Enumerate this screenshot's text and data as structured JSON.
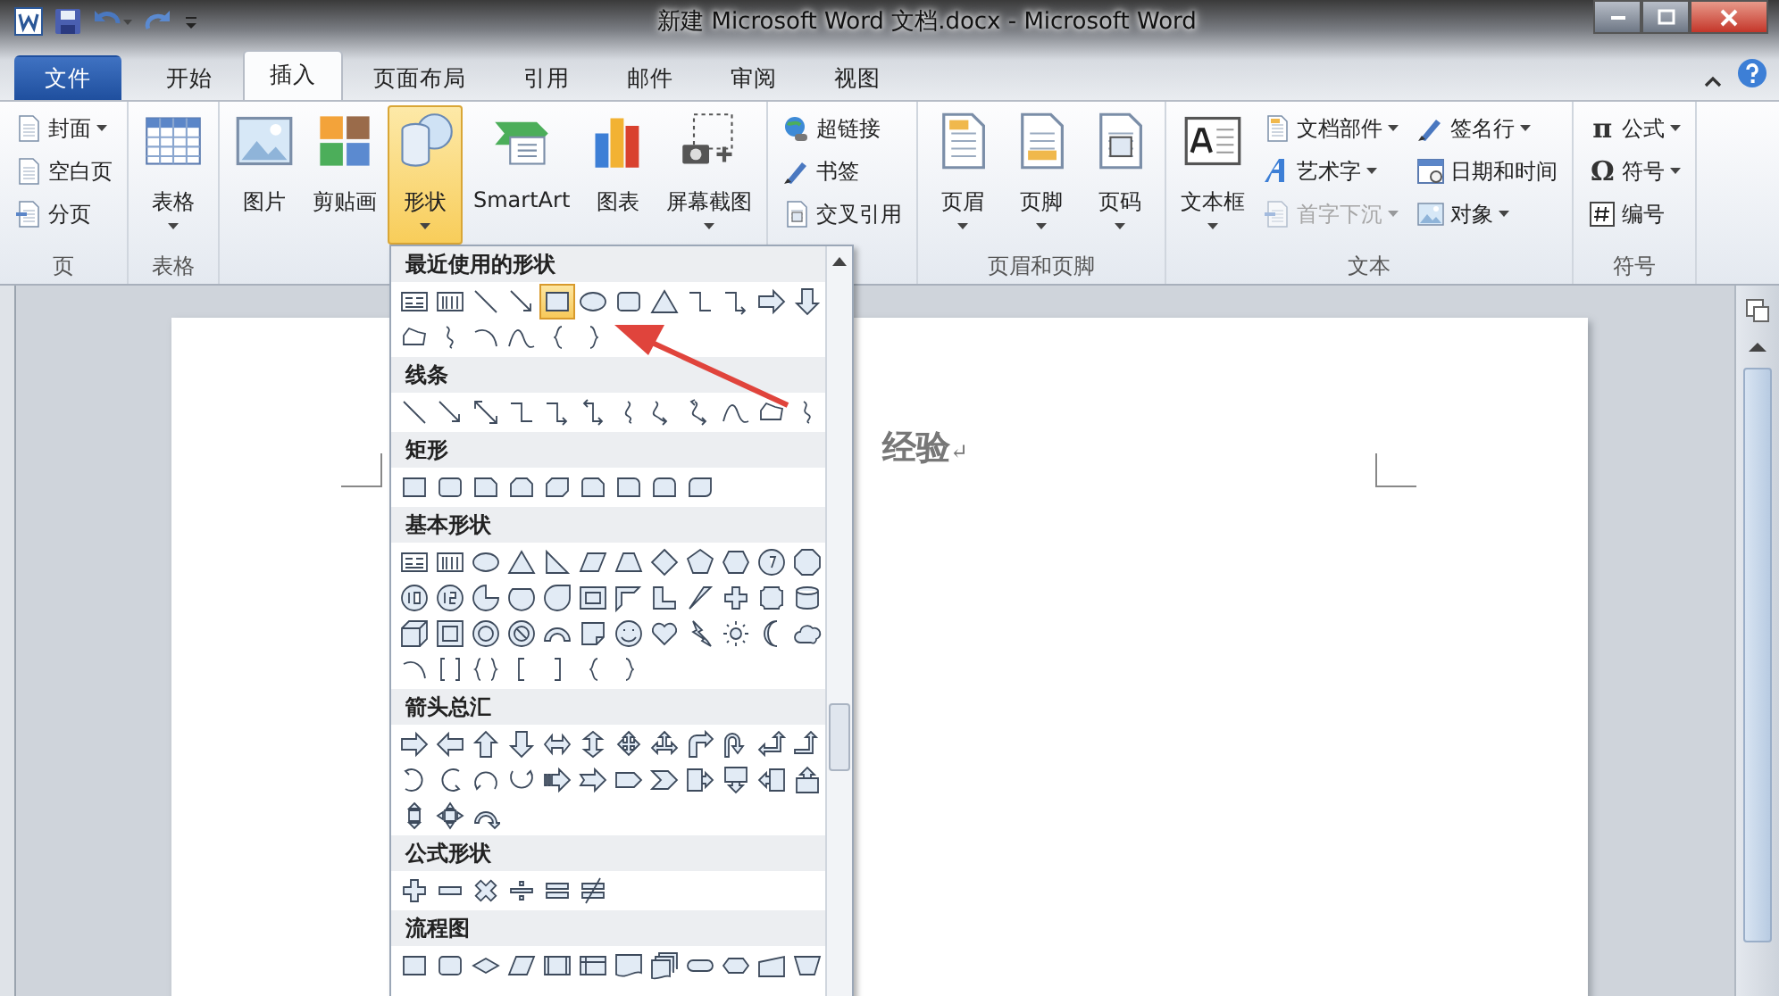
{
  "window": {
    "title": "新建 Microsoft Word 文档.docx - Microsoft Word"
  },
  "tabs": [
    {
      "label": "文件",
      "kind": "file",
      "selected": false
    },
    {
      "label": "开始",
      "kind": "tab",
      "selected": false
    },
    {
      "label": "插入",
      "kind": "tab",
      "selected": true
    },
    {
      "label": "页面布局",
      "kind": "tab",
      "selected": false
    },
    {
      "label": "引用",
      "kind": "tab",
      "selected": false
    },
    {
      "label": "邮件",
      "kind": "tab",
      "selected": false
    },
    {
      "label": "审阅",
      "kind": "tab",
      "selected": false
    },
    {
      "label": "视图",
      "kind": "tab",
      "selected": false
    }
  ],
  "ribbon": {
    "groups": [
      {
        "label": "页",
        "columns": [
          [
            {
              "kind": "small",
              "label": "封面",
              "dropdown": true,
              "pressed": false,
              "disabled": false
            },
            {
              "kind": "small",
              "label": "空白页",
              "dropdown": false,
              "pressed": false,
              "disabled": false
            },
            {
              "kind": "small",
              "label": "分页",
              "dropdown": false,
              "pressed": false,
              "disabled": false
            }
          ]
        ]
      },
      {
        "label": "表格",
        "columns": [
          [
            {
              "kind": "large",
              "label": "表格",
              "dropdown": true,
              "pressed": false,
              "disabled": false
            }
          ]
        ]
      },
      {
        "columns": [
          [
            {
              "kind": "large",
              "label": "图片",
              "dropdown": false,
              "pressed": false,
              "disabled": false
            }
          ],
          [
            {
              "kind": "large",
              "label": "剪贴画",
              "dropdown": false,
              "pressed": false,
              "disabled": false
            }
          ],
          [
            {
              "kind": "large",
              "label": "形状",
              "dropdown": true,
              "pressed": true,
              "disabled": false
            }
          ],
          [
            {
              "kind": "large",
              "label": "SmartArt",
              "dropdown": false,
              "pressed": false,
              "disabled": false
            }
          ],
          [
            {
              "kind": "large",
              "label": "图表",
              "dropdown": false,
              "pressed": false,
              "disabled": false
            }
          ],
          [
            {
              "kind": "large",
              "label": "屏幕截图",
              "dropdown": true,
              "pressed": false,
              "disabled": false
            }
          ]
        ]
      },
      {
        "columns": [
          [
            {
              "kind": "small",
              "label": "超链接",
              "dropdown": false,
              "pressed": false,
              "disabled": false
            },
            {
              "kind": "small",
              "label": "书签",
              "dropdown": false,
              "pressed": false,
              "disabled": false
            },
            {
              "kind": "small",
              "label": "交叉引用",
              "dropdown": false,
              "pressed": false,
              "disabled": false
            }
          ]
        ]
      },
      {
        "label": "页眉和页脚",
        "columns": [
          [
            {
              "kind": "large",
              "label": "页眉",
              "dropdown": true,
              "pressed": false,
              "disabled": false
            }
          ],
          [
            {
              "kind": "large",
              "label": "页脚",
              "dropdown": true,
              "pressed": false,
              "disabled": false
            }
          ],
          [
            {
              "kind": "large",
              "label": "页码",
              "dropdown": true,
              "pressed": false,
              "disabled": false
            }
          ]
        ]
      },
      {
        "label": "文本",
        "columns": [
          [
            {
              "kind": "large",
              "label": "文本框",
              "dropdown": true,
              "pressed": false,
              "disabled": false
            }
          ],
          [
            {
              "kind": "small",
              "label": "文档部件",
              "dropdown": true,
              "pressed": false,
              "disabled": false
            },
            {
              "kind": "small",
              "label": "艺术字",
              "dropdown": true,
              "pressed": false,
              "disabled": false
            },
            {
              "kind": "small",
              "label": "首字下沉",
              "dropdown": true,
              "pressed": false,
              "disabled": true
            }
          ],
          [
            {
              "kind": "small",
              "label": "签名行",
              "dropdown": true,
              "pressed": false,
              "disabled": false
            },
            {
              "kind": "small",
              "label": "日期和时间",
              "dropdown": false,
              "pressed": false,
              "disabled": false
            },
            {
              "kind": "small",
              "label": "对象",
              "dropdown": true,
              "pressed": false,
              "disabled": false
            }
          ]
        ]
      },
      {
        "label": "符号",
        "columns": [
          [
            {
              "kind": "small",
              "label": "公式",
              "glyph": "π",
              "dropdown": true,
              "pressed": false,
              "disabled": false
            },
            {
              "kind": "small",
              "label": "符号",
              "glyph": "Ω",
              "dropdown": true,
              "pressed": false,
              "disabled": false
            },
            {
              "kind": "small",
              "label": "编号",
              "dropdown": false,
              "pressed": false,
              "disabled": false
            }
          ]
        ]
      }
    ]
  },
  "shapes_menu": {
    "sections": [
      {
        "title": "最近使用的形状",
        "shapes": [
          {
            "kind": "textbox",
            "selected": false
          },
          {
            "kind": "vtextbox",
            "selected": false
          },
          {
            "kind": "line",
            "selected": false
          },
          {
            "kind": "arrow-line",
            "selected": false
          },
          {
            "kind": "rect",
            "selected": true
          },
          {
            "kind": "ellipse",
            "selected": false
          },
          {
            "kind": "round-rect",
            "selected": false
          },
          {
            "kind": "triangle",
            "selected": false
          },
          {
            "kind": "elbow",
            "selected": false
          },
          {
            "kind": "elbow-arrow",
            "selected": false
          },
          {
            "kind": "arrow-right",
            "selected": false
          },
          {
            "kind": "arrow-down",
            "selected": false
          },
          {
            "kind": "freeform",
            "selected": false
          },
          {
            "kind": "scribble",
            "selected": false
          },
          {
            "kind": "arc",
            "selected": false
          },
          {
            "kind": "curve",
            "selected": false
          },
          {
            "kind": "brace-left",
            "selected": false
          },
          {
            "kind": "brace-right",
            "selected": false
          }
        ]
      },
      {
        "title": "线条",
        "shapes": [
          {
            "kind": "line",
            "selected": false
          },
          {
            "kind": "arrow-line",
            "selected": false
          },
          {
            "kind": "double-arrow",
            "selected": false
          },
          {
            "kind": "elbow",
            "selected": false
          },
          {
            "kind": "elbow-arrow",
            "selected": false
          },
          {
            "kind": "elbow-double",
            "selected": false
          },
          {
            "kind": "curve-s",
            "selected": false
          },
          {
            "kind": "curve-arrow",
            "selected": false
          },
          {
            "kind": "curve-double",
            "selected": false
          },
          {
            "kind": "curve",
            "selected": false
          },
          {
            "kind": "freeform",
            "selected": false
          },
          {
            "kind": "scribble",
            "selected": false
          }
        ]
      },
      {
        "title": "矩形",
        "shapes": [
          {
            "kind": "rect",
            "selected": false
          },
          {
            "kind": "round-rect",
            "selected": false
          },
          {
            "kind": "snip",
            "selected": false
          },
          {
            "kind": "snip-two",
            "selected": false
          },
          {
            "kind": "snip-diag",
            "selected": false
          },
          {
            "kind": "snip-round",
            "selected": false
          },
          {
            "kind": "round-one",
            "selected": false
          },
          {
            "kind": "round-two",
            "selected": false
          },
          {
            "kind": "round-diag",
            "selected": false
          }
        ]
      },
      {
        "title": "基本形状",
        "shapes": [
          {
            "kind": "textbox",
            "selected": false
          },
          {
            "kind": "vtextbox",
            "selected": false
          },
          {
            "kind": "ellipse",
            "selected": false
          },
          {
            "kind": "triangle",
            "selected": false
          },
          {
            "kind": "right-triangle",
            "selected": false
          },
          {
            "kind": "parallelogram",
            "selected": false
          },
          {
            "kind": "trapezoid",
            "selected": false
          },
          {
            "kind": "diamond",
            "selected": false
          },
          {
            "kind": "pentagon",
            "selected": false
          },
          {
            "kind": "hexagon",
            "selected": false
          },
          {
            "kind": "heptagon",
            "selected": false
          },
          {
            "kind": "octagon",
            "selected": false
          },
          {
            "kind": "decagon",
            "selected": false
          },
          {
            "kind": "dodecagon",
            "selected": false
          },
          {
            "kind": "pie",
            "selected": false
          },
          {
            "kind": "chord",
            "selected": false
          },
          {
            "kind": "teardrop",
            "selected": false
          },
          {
            "kind": "frame",
            "selected": false
          },
          {
            "kind": "half-frame",
            "selected": false
          },
          {
            "kind": "l-shape",
            "selected": false
          },
          {
            "kind": "stripe",
            "selected": false
          },
          {
            "kind": "cross",
            "selected": false
          },
          {
            "kind": "plaque",
            "selected": false
          },
          {
            "kind": "can",
            "selected": false
          },
          {
            "kind": "cube",
            "selected": false
          },
          {
            "kind": "bevel",
            "selected": false
          },
          {
            "kind": "donut",
            "selected": false
          },
          {
            "kind": "no-symbol",
            "selected": false
          },
          {
            "kind": "block-arc",
            "selected": false
          },
          {
            "kind": "folded",
            "selected": false
          },
          {
            "kind": "smiley",
            "selected": false
          },
          {
            "kind": "heart",
            "selected": false
          },
          {
            "kind": "lightning",
            "selected": false
          },
          {
            "kind": "sun",
            "selected": false
          },
          {
            "kind": "moon",
            "selected": false
          },
          {
            "kind": "cloud",
            "selected": false
          },
          {
            "kind": "arc",
            "selected": false
          },
          {
            "kind": "bracket-pair",
            "selected": false
          },
          {
            "kind": "brace-pair",
            "selected": false
          },
          {
            "kind": "bracket-left",
            "selected": false
          },
          {
            "kind": "bracket-right",
            "selected": false
          },
          {
            "kind": "brace-left",
            "selected": false
          },
          {
            "kind": "brace-right",
            "selected": false
          }
        ]
      },
      {
        "title": "箭头总汇",
        "shapes": [
          {
            "kind": "arrow-right",
            "selected": false
          },
          {
            "kind": "arrow-left",
            "selected": false
          },
          {
            "kind": "arrow-up",
            "selected": false
          },
          {
            "kind": "arrow-down",
            "selected": false
          },
          {
            "kind": "arrow-lr",
            "selected": false
          },
          {
            "kind": "arrow-ud",
            "selected": false
          },
          {
            "kind": "arrow-quad",
            "selected": false
          },
          {
            "kind": "arrow-lru",
            "selected": false
          },
          {
            "kind": "arrow-bent",
            "selected": false
          },
          {
            "kind": "arrow-uturn",
            "selected": false
          },
          {
            "kind": "arrow-left-up",
            "selected": false
          },
          {
            "kind": "arrow-bent-up",
            "selected": false
          },
          {
            "kind": "curved-right",
            "selected": false
          },
          {
            "kind": "curved-left",
            "selected": false
          },
          {
            "kind": "curved-up",
            "selected": false
          },
          {
            "kind": "curved-down",
            "selected": false
          },
          {
            "kind": "arrow-striped",
            "selected": false
          },
          {
            "kind": "arrow-notched",
            "selected": false
          },
          {
            "kind": "pentagon-arrow",
            "selected": false
          },
          {
            "kind": "chevron",
            "selected": false
          },
          {
            "kind": "callout-right",
            "selected": false
          },
          {
            "kind": "callout-down",
            "selected": false
          },
          {
            "kind": "callout-left",
            "selected": false
          },
          {
            "kind": "callout-up",
            "selected": false
          },
          {
            "kind": "callout-ud",
            "selected": false
          },
          {
            "kind": "callout-quad",
            "selected": false
          },
          {
            "kind": "arrow-circular",
            "selected": false
          }
        ]
      },
      {
        "title": "公式形状",
        "shapes": [
          {
            "kind": "plus",
            "selected": false
          },
          {
            "kind": "minus",
            "selected": false
          },
          {
            "kind": "multiply",
            "selected": false
          },
          {
            "kind": "divide",
            "selected": false
          },
          {
            "kind": "equal",
            "selected": false
          },
          {
            "kind": "not-equal",
            "selected": false
          }
        ]
      },
      {
        "title": "流程图",
        "shapes": [
          {
            "kind": "rect",
            "selected": false
          },
          {
            "kind": "round-rect",
            "selected": false
          },
          {
            "kind": "decision",
            "selected": false
          },
          {
            "kind": "parallelogram",
            "selected": false
          },
          {
            "kind": "predefined",
            "selected": false
          },
          {
            "kind": "internal",
            "selected": false
          },
          {
            "kind": "document",
            "selected": false
          },
          {
            "kind": "multidoc",
            "selected": false
          },
          {
            "kind": "terminator",
            "selected": false
          },
          {
            "kind": "preparation",
            "selected": false
          },
          {
            "kind": "manual-input",
            "selected": false
          },
          {
            "kind": "manual-op",
            "selected": false
          }
        ]
      }
    ]
  },
  "document": {
    "text": "经验",
    "paragraph_mark": "↵"
  }
}
